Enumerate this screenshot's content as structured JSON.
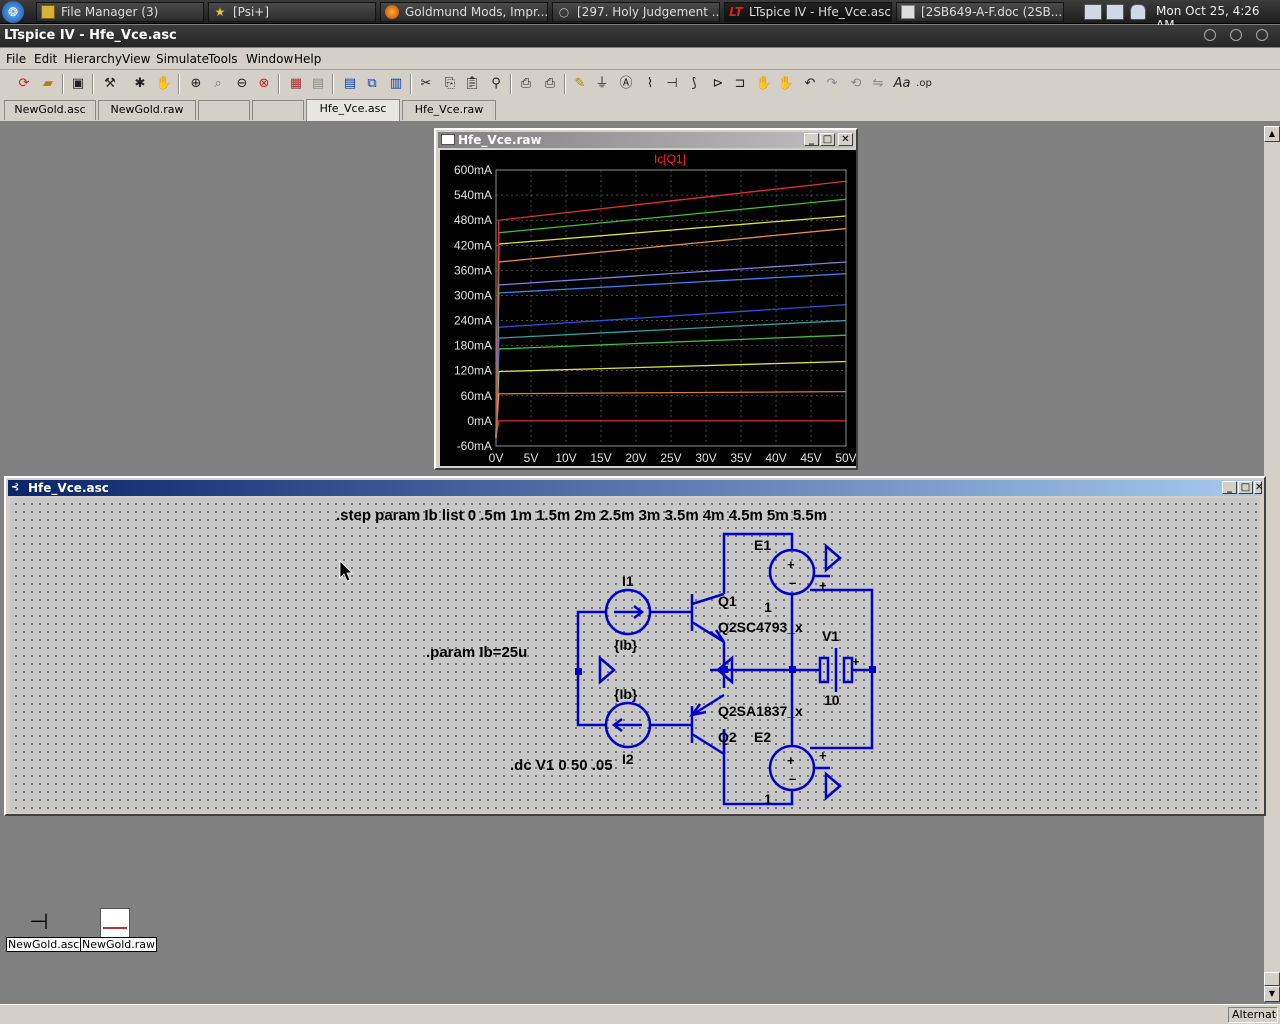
{
  "taskbar": {
    "tasks": [
      {
        "label": "File Manager (3)",
        "icon": "folder-icon"
      },
      {
        "label": "[Psi+]",
        "icon": "star-icon"
      },
      {
        "label": "Goldmund Mods, Impr...",
        "icon": "firefox-icon"
      },
      {
        "label": "[297. Holy Judgement ...",
        "icon": "circle-icon"
      },
      {
        "label": "LTspice IV - Hfe_Vce.asc",
        "icon": "ltspice-icon"
      },
      {
        "label": "[2SB649-A-F.doc (2SB...",
        "icon": "document-icon"
      }
    ],
    "clock": "Mon Oct 25,  4:26 AM"
  },
  "app": {
    "title": "LTspice IV - Hfe_Vce.asc"
  },
  "menu": [
    "File",
    "Edit",
    "Hierarchy",
    "View",
    "Simulate",
    "Tools",
    "Window",
    "Help"
  ],
  "tabs": [
    "NewGold.asc",
    "NewGold.raw",
    "",
    "",
    "Hfe_Vce.asc",
    "Hfe_Vce.raw"
  ],
  "plot_window": {
    "title": "Hfe_Vce.raw"
  },
  "schematic_window": {
    "title": "Hfe_Vce.asc"
  },
  "schematic": {
    "step_directive": ".step param Ib list 0 .5m 1m 1.5m 2m 2.5m 3m 3.5m 4m 4.5m 5m 5.5m",
    "param_directive": ".param Ib=25u",
    "dc_directive": ".dc V1 0 50 .05",
    "labels": {
      "I1": "I1",
      "I2": "I2",
      "Ib_top": "{Ib}",
      "Ib_bottom": "{Ib}",
      "Q1": "Q1",
      "Q1_model": "Q2SC4793_x",
      "Q2": "Q2",
      "Q2_model": "Q2SA1837_x",
      "E1": "E1",
      "E1_gain": "1",
      "E2": "E2",
      "E2_gain": "1",
      "V1": "V1",
      "V1_value": "10"
    }
  },
  "desktop_icons": [
    {
      "label": "NewGold.asc",
      "icon": "transistor-icon"
    },
    {
      "label": "NewGold.raw",
      "icon": "waveform-icon"
    }
  ],
  "status": {
    "right_text": "Alternate"
  },
  "colors": {
    "schematic_wire": "#0000c8",
    "plot_background": "#000000",
    "trace_title": "#ff2020"
  },
  "chart_data": {
    "type": "line",
    "title": "Ic[Q1]",
    "xlabel": "",
    "ylabel": "",
    "x_ticks": [
      "0V",
      "5V",
      "10V",
      "15V",
      "20V",
      "25V",
      "30V",
      "35V",
      "40V",
      "45V",
      "50V"
    ],
    "y_ticks": [
      "600mA",
      "540mA",
      "480mA",
      "420mA",
      "360mA",
      "300mA",
      "240mA",
      "180mA",
      "120mA",
      "60mA",
      "0mA",
      "-60mA"
    ],
    "xlim": [
      0,
      50
    ],
    "ylim": [
      -60,
      600
    ],
    "x_unit": "V",
    "y_unit": "mA",
    "grid": true,
    "knee_x": 0.4,
    "series": [
      {
        "color": "#d83030",
        "start": 0,
        "end": 0
      },
      {
        "color": "#e07a30",
        "start": 65,
        "end": 70
      },
      {
        "color": "#e0e040",
        "start": 118,
        "end": 142
      },
      {
        "color": "#40c040",
        "start": 172,
        "end": 205
      },
      {
        "color": "#30a0a0",
        "start": 198,
        "end": 240
      },
      {
        "color": "#3050e0",
        "start": 224,
        "end": 278
      },
      {
        "color": "#4080f0",
        "start": 306,
        "end": 352
      },
      {
        "color": "#8080e0",
        "start": 325,
        "end": 380
      },
      {
        "color": "#e09050",
        "start": 380,
        "end": 460
      },
      {
        "color": "#e0e040",
        "start": 423,
        "end": 490
      },
      {
        "color": "#40c040",
        "start": 450,
        "end": 530
      },
      {
        "color": "#e03030",
        "start": 480,
        "end": 573
      }
    ]
  }
}
